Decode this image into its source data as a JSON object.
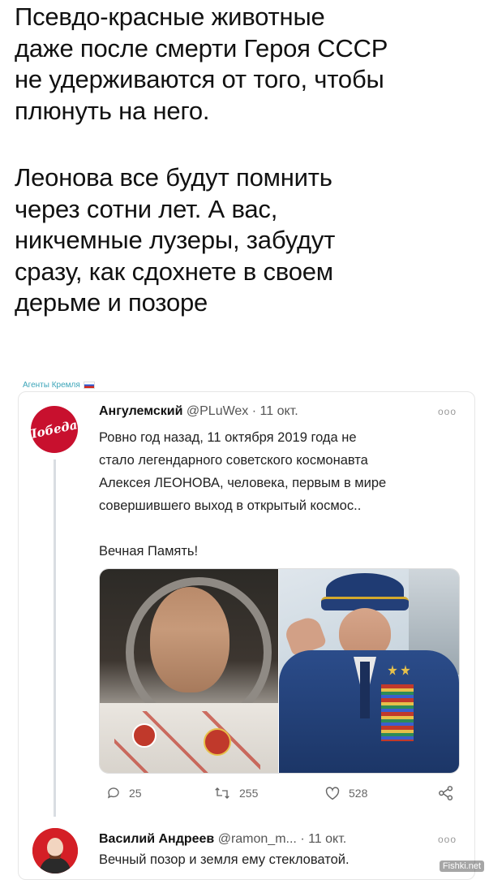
{
  "headline": {
    "line1": "Псевдо-красные животные",
    "line2": "даже после смерти Героя СССР",
    "line3": "не удерживаются от того, чтобы",
    "line4": "плюнуть на него.",
    "line5": "Леонова все будут помнить",
    "line6": "через сотни лет. А вас,",
    "line7": "никчемные лузеры, забудут",
    "line8": "сразу, как сдохнете в своем",
    "line9": "дерьме и позоре"
  },
  "source_label": "Агенты Кремля",
  "tweet1": {
    "avatar_text": "Победа!",
    "author": "Ангулемский",
    "handle": "@PLuWex",
    "separator": "·",
    "date": "11 окт.",
    "more": "ooo",
    "text_lines": [
      "Ровно год назад, 11 октября 2019 года не",
      "стало легендарного советского космонавта",
      "Алексея ЛЕОНОВА, человека, первым в мире",
      "совершившего выход в открытый космос.."
    ],
    "memorial": "Вечная Память!",
    "actions": {
      "reply_icon": "speech-bubble-icon",
      "reply_count": "25",
      "retweet_icon": "retweet-icon",
      "retweet_count": "255",
      "like_icon": "heart-icon",
      "like_count": "528",
      "share_icon": "share-icon"
    }
  },
  "tweet2": {
    "author": "Василий Андреев",
    "handle": "@ramon_m...",
    "separator": "·",
    "date": "11 окт.",
    "more": "ooo",
    "text": "Вечный позор и земля ему стекловатой."
  },
  "watermark": "Fishki.net",
  "colors": {
    "accent": "#3aa4b8",
    "avatar_red": "#c8102e"
  }
}
